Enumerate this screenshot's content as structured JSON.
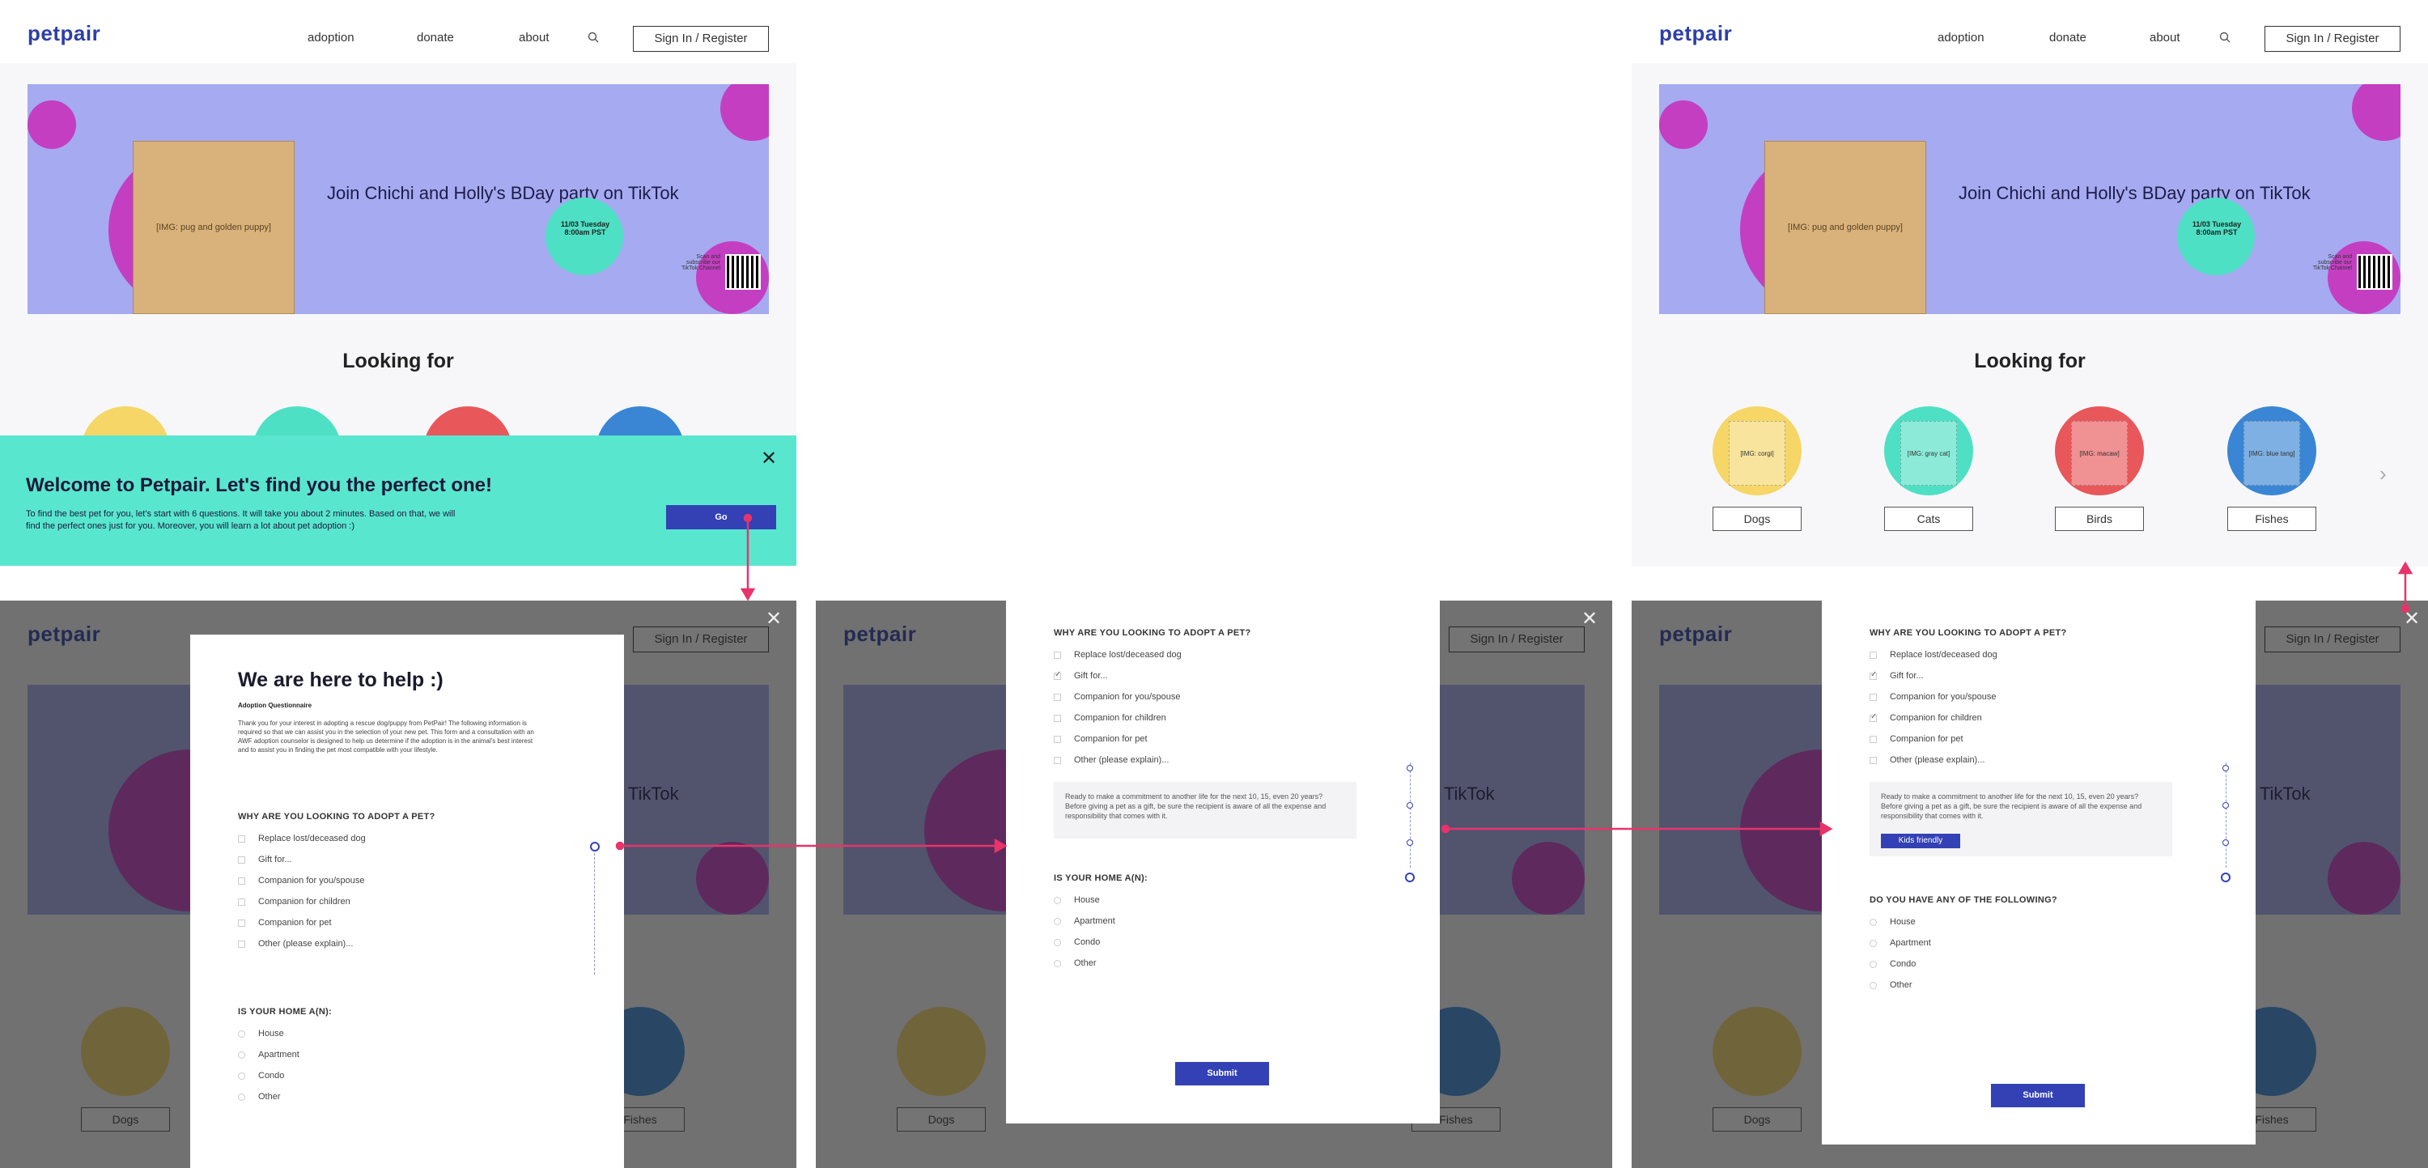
{
  "brand": "petpair",
  "nav": {
    "adoption": "adoption",
    "donate": "donate",
    "about": "about",
    "signin": "Sign In / Register"
  },
  "banner": {
    "headline": "Join  Chichi  and Holly's BDay party on TikTok",
    "event_date": "11/03 Tuesday",
    "event_time": "8:00am PST",
    "qr_caption": "Scan and subscribe our TikTok Channel"
  },
  "looking_for": {
    "title": "Looking for",
    "pets": [
      {
        "label": "Dogs",
        "color": "#f5d667"
      },
      {
        "label": "Cats",
        "color": "#4ee0c4"
      },
      {
        "label": "Birds",
        "color": "#e8575a"
      },
      {
        "label": "Fishes",
        "color": "#3a86d4"
      }
    ]
  },
  "welcome": {
    "title": "Welcome to Petpair. Let's find you the perfect one!",
    "body": "To find the best pet for you, let's start with 6 questions. It will take you about 2 minutes. Based on that, we will find the perfect ones just for you. Moreover, you will learn a lot about pet adoption :)",
    "go": "Go"
  },
  "questionnaire": {
    "title": "We are here to help :)",
    "subtitle": "Adoption Questionnaire",
    "intro": "Thank you for your interest in adopting a rescue dog/puppy from PetPair! The following information is required so that we can assist you in the selection of your new pet. This form and a consultation with an AWF adoption counselor is designed to help us determine if the adoption is in the animal's best interest and to assist you in finding the pet most compatible with your lifestyle.",
    "q1": {
      "title": "WHY ARE YOU LOOKING TO ADOPT A PET?",
      "options": [
        "Replace lost/deceased dog",
        "Gift for...",
        "Companion for you/spouse",
        "Companion for children",
        "Companion for pet",
        "Other (please explain)..."
      ]
    },
    "q1_note": "Ready to make a commitment to another life for the next 10, 15, even 20 years? Before giving a pet as a gift, be sure the recipient is aware of all the expense and responsibility that comes with it.",
    "q2": {
      "title": "IS YOUR HOME A(N):",
      "options": [
        "House",
        "Apartment",
        "Condo",
        "Other"
      ]
    },
    "q3": {
      "title": "DO YOU HAVE ANY OF THE FOLLOWING?",
      "options": [
        "House",
        "Apartment",
        "Condo",
        "Other"
      ]
    },
    "tag": "Kids friendly",
    "submit": "Submit"
  },
  "colors": {
    "brand": "#2d3fa6",
    "accent_mint": "#59e6cf",
    "primary_button": "#3341b5",
    "arrow": "#e8336b",
    "banner": "#a6aaf0"
  },
  "icons": [
    "search-icon",
    "close-icon",
    "chevron-right-icon",
    "checkbox-icon",
    "radio-icon"
  ]
}
